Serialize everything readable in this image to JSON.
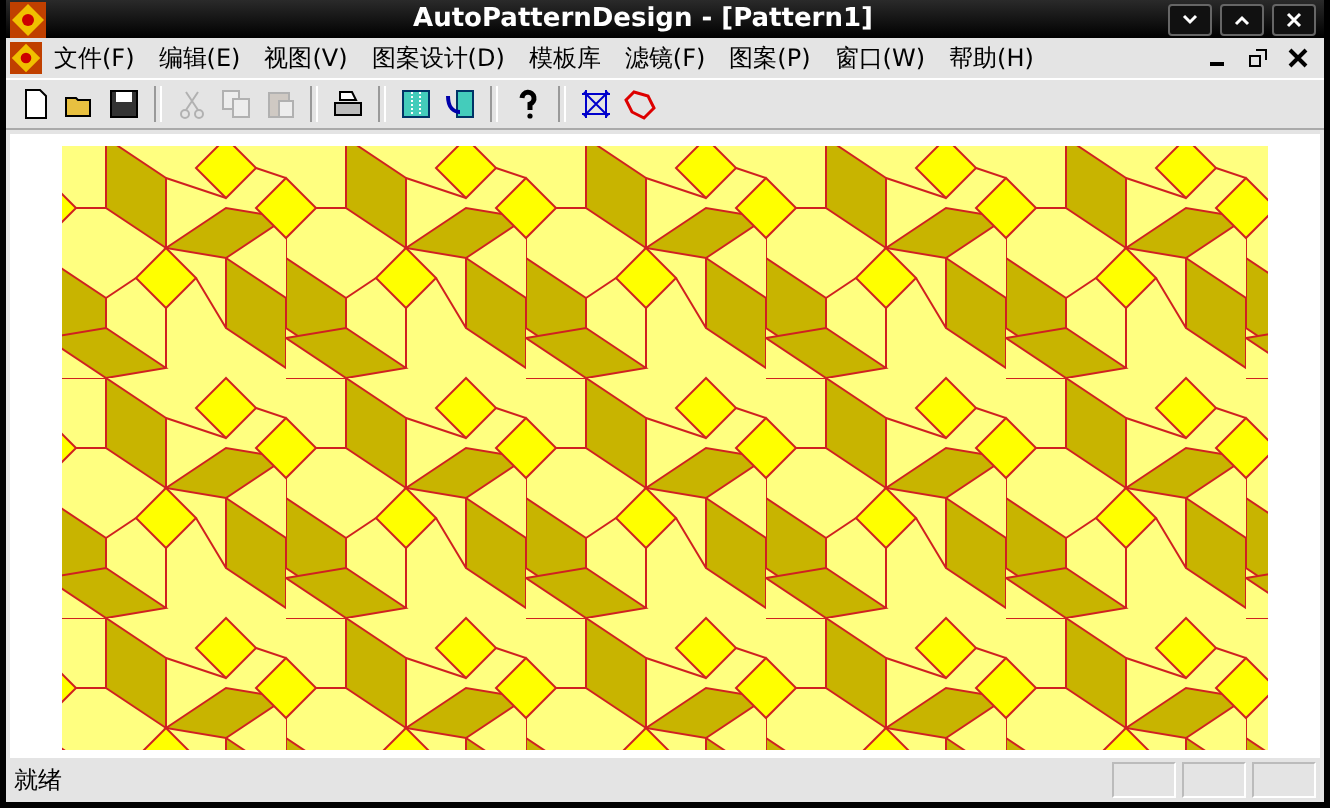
{
  "window": {
    "title": "AutoPatternDesign - [Pattern1]"
  },
  "menu": [
    "文件(F)",
    "编辑(E)",
    "视图(V)",
    "图案设计(D)",
    "模板库",
    "滤镜(F)",
    "图案(P)",
    "窗口(W)",
    "帮助(H)"
  ],
  "toolbar": [
    {
      "kind": "new",
      "disabled": false
    },
    {
      "kind": "open",
      "disabled": false
    },
    {
      "kind": "save",
      "disabled": false
    },
    {
      "kind": "sep"
    },
    {
      "kind": "cut",
      "disabled": true
    },
    {
      "kind": "copy",
      "disabled": true
    },
    {
      "kind": "paste",
      "disabled": true
    },
    {
      "kind": "sep"
    },
    {
      "kind": "print",
      "disabled": false
    },
    {
      "kind": "sep"
    },
    {
      "kind": "grid",
      "disabled": false
    },
    {
      "kind": "flip",
      "disabled": false
    },
    {
      "kind": "sep"
    },
    {
      "kind": "help",
      "disabled": false
    },
    {
      "kind": "sep"
    },
    {
      "kind": "mesh",
      "disabled": false
    },
    {
      "kind": "polygon",
      "disabled": false
    }
  ],
  "status_bar": {
    "text": "就绪"
  }
}
